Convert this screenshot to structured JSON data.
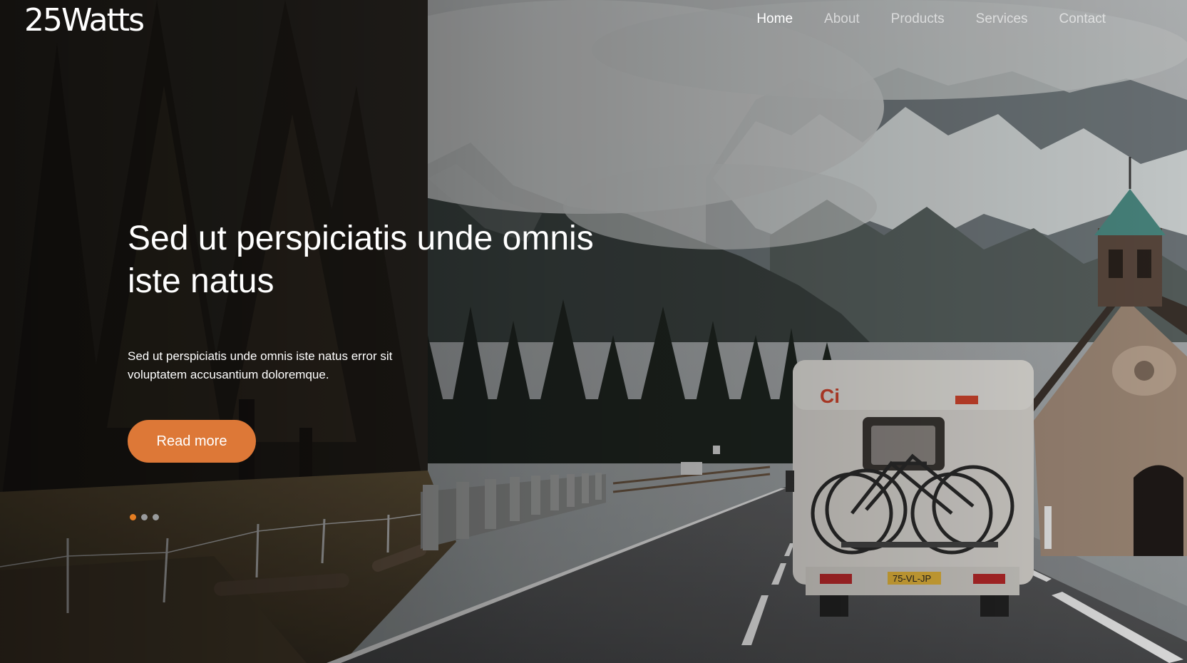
{
  "brand": {
    "logo_text": "25Watts"
  },
  "nav": {
    "items": [
      {
        "label": "Home",
        "active": true
      },
      {
        "label": "About",
        "active": false
      },
      {
        "label": "Products",
        "active": false
      },
      {
        "label": "Services",
        "active": false
      },
      {
        "label": "Contact",
        "active": false
      }
    ]
  },
  "hero": {
    "title_line1": "Sed ut perspiciatis unde omnis",
    "title_line2": "iste natus",
    "text_line1": "Sed ut perspiciatis unde omnis iste natus error sit",
    "text_line2": "voluptatem accusantium doloremque.",
    "button_label": "Read more",
    "slide_count": 3,
    "active_slide": 1
  },
  "colors": {
    "accent": "#dd7837",
    "dot_active": "#e67e22",
    "nav_active": "#ffffff"
  }
}
